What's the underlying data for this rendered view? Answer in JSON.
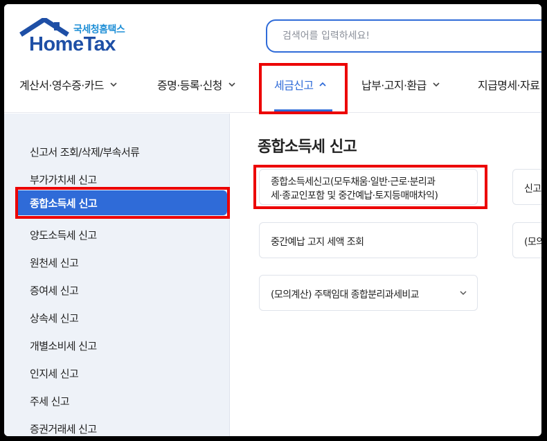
{
  "logo": {
    "korean": "국세청홈택스",
    "english": "HomeTax"
  },
  "search": {
    "placeholder": "검색어를 입력하세요!"
  },
  "nav": [
    {
      "label": "계산서·영수증·카드",
      "active": false
    },
    {
      "label": "증명·등록·신청",
      "active": false
    },
    {
      "label": "세금신고",
      "active": true
    },
    {
      "label": "납부·고지·환급",
      "active": false
    },
    {
      "label": "지급명세·자료"
    }
  ],
  "sidebar": {
    "items": [
      "신고서 조회/삭제/부속서류",
      "부가가치세 신고",
      "종합소득세 신고",
      "양도소득세 신고",
      "원천세 신고",
      "증여세 신고",
      "상속세 신고",
      "개별소비세 신고",
      "인지세 신고",
      "주세 신고",
      "증권거래세 신고"
    ],
    "active_index": 2
  },
  "main": {
    "title": "종합소득세 신고",
    "cards": [
      {
        "line1": "종합소득세신고(모두채움·일반·근로·분리과",
        "line2": "세·종교인포함 및 중간예납·토지등매매차익)"
      },
      {
        "label": "중간예납 고지 세액 조회"
      },
      {
        "label": "(모의계산) 주택임대 종합분리과세비교"
      }
    ],
    "partial_cards": [
      "신고",
      "(모의"
    ]
  },
  "colors": {
    "accent": "#2f6bd8",
    "highlight": "#ec0000",
    "sidebar_bg": "#eef2f8"
  }
}
